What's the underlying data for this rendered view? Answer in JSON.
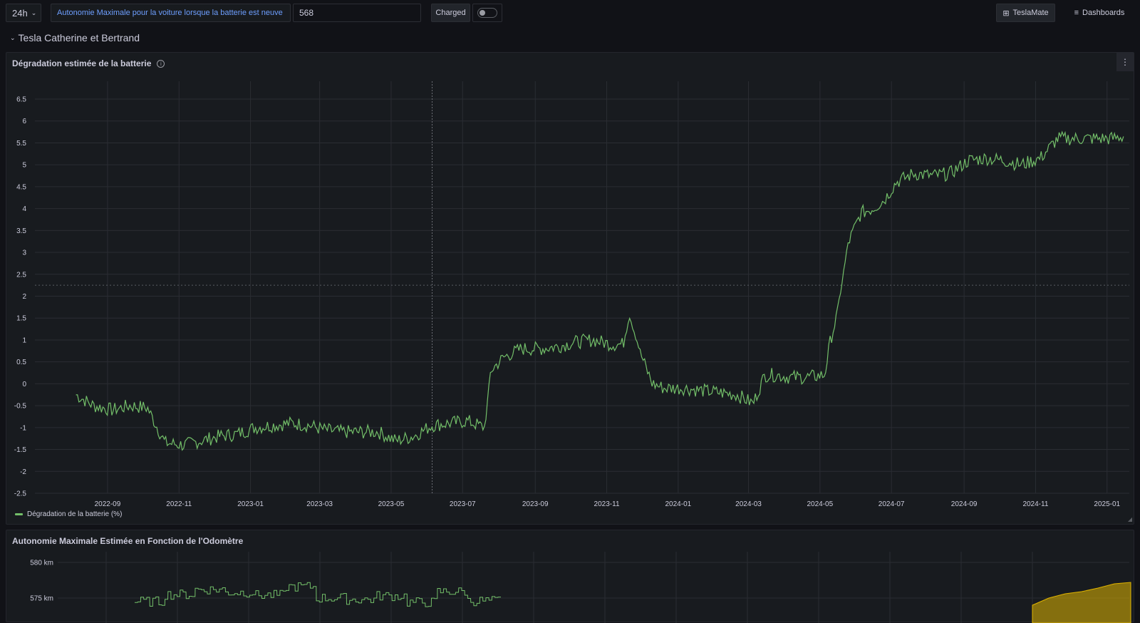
{
  "topbar": {
    "time_range": "24h",
    "variable_label": "Autonomie Maximale pour la voiture lorsque la batterie est neuve",
    "variable_value": "568",
    "charged_label": "Charged",
    "teslamate_label": "TeslaMate",
    "dashboards_label": "Dashboards"
  },
  "row": {
    "title": "Tesla Catherine et Bertrand"
  },
  "panel1": {
    "title": "Dégradation estimée de la batterie",
    "legend": "Dégradation de la batterie (%)"
  },
  "panel2": {
    "title": "Autonomie Maximale Estimée en Fonction de l'Odomètre"
  },
  "colors": {
    "background": "#111217",
    "panel": "#181b1f",
    "series_green": "#73bf69",
    "series_yellow": "#e0b400",
    "grid": "#2a2d33",
    "accent_blue": "#6e9fff"
  },
  "chart_data": [
    {
      "type": "line",
      "title": "Dégradation estimée de la batterie",
      "x_ticks": [
        "2022-09",
        "2022-11",
        "2023-01",
        "2023-03",
        "2023-05",
        "2023-07",
        "2023-09",
        "2023-11",
        "2024-01",
        "2024-03",
        "2024-05",
        "2024-07",
        "2024-09",
        "2024-11",
        "2025-01"
      ],
      "y_ticks": [
        "6.5",
        "6",
        "5.5",
        "5",
        "4.5",
        "4",
        "3.5",
        "3",
        "2.5",
        "2",
        "1.5",
        "1",
        "0.5",
        "0",
        "-0.5",
        "-1",
        "-1.5",
        "-2",
        "-2.5"
      ],
      "ylim": [
        -2.5,
        6.5
      ],
      "threshold": 2.25,
      "grid": true,
      "legend_position": "bottom-left",
      "series": [
        {
          "name": "Dégradation de la batterie (%)",
          "color": "#73bf69",
          "x": [
            "2022-08-05",
            "2022-08-20",
            "2022-09-05",
            "2022-09-20",
            "2022-10-05",
            "2022-10-20",
            "2022-11-05",
            "2022-11-20",
            "2022-12-05",
            "2022-12-20",
            "2023-01-05",
            "2023-01-20",
            "2023-02-05",
            "2023-02-20",
            "2023-03-05",
            "2023-03-20",
            "2023-04-05",
            "2023-04-20",
            "2023-05-05",
            "2023-05-20",
            "2023-06-05",
            "2023-06-20",
            "2023-07-05",
            "2023-07-20",
            "2023-07-25",
            "2023-08-05",
            "2023-08-20",
            "2023-09-05",
            "2023-09-20",
            "2023-10-05",
            "2023-10-20",
            "2023-11-05",
            "2023-11-15",
            "2023-11-20",
            "2023-12-01",
            "2023-12-10",
            "2023-12-20",
            "2024-01-05",
            "2024-01-20",
            "2024-02-05",
            "2024-02-20",
            "2024-03-05",
            "2024-03-15",
            "2024-03-25",
            "2024-04-05",
            "2024-04-20",
            "2024-05-05",
            "2024-05-10",
            "2024-05-15",
            "2024-05-25",
            "2024-06-05",
            "2024-06-15",
            "2024-06-25",
            "2024-07-05",
            "2024-07-20",
            "2024-08-05",
            "2024-08-20",
            "2024-09-05",
            "2024-09-20",
            "2024-10-05",
            "2024-10-20",
            "2024-11-05",
            "2024-11-20",
            "2024-12-05",
            "2024-12-20",
            "2025-01-05",
            "2025-01-15"
          ],
          "values": [
            -0.25,
            -0.5,
            -0.6,
            -0.5,
            -0.55,
            -1.35,
            -1.4,
            -1.3,
            -1.2,
            -1.15,
            -1.0,
            -0.95,
            -0.9,
            -0.95,
            -1.05,
            -1.1,
            -1.1,
            -1.1,
            -1.3,
            -1.2,
            -0.95,
            -0.9,
            -0.85,
            -1.0,
            0.3,
            0.6,
            0.8,
            0.8,
            0.85,
            0.95,
            1.0,
            0.9,
            0.9,
            1.6,
            0.6,
            0.0,
            -0.1,
            -0.1,
            -0.15,
            -0.2,
            -0.25,
            -0.45,
            0.2,
            0.2,
            0.15,
            0.15,
            0.2,
            1.0,
            1.5,
            3.2,
            3.9,
            4.0,
            4.2,
            4.6,
            4.8,
            4.75,
            4.8,
            5.1,
            5.15,
            5.1,
            5.0,
            5.15,
            5.6,
            5.6,
            5.6,
            5.6,
            5.65
          ]
        }
      ]
    },
    {
      "type": "bar",
      "title": "Autonomie Maximale Estimée en Fonction de l'Odomètre",
      "y_ticks": [
        "580 km",
        "575 km"
      ],
      "series": [
        {
          "color": "#73bf69",
          "values": [
            574.5,
            575.5,
            576.2,
            575.8,
            575.4,
            576.6,
            575.0,
            574.8,
            575.3,
            574.4,
            575.9,
            574.6
          ]
        },
        {
          "color": "#e0b400",
          "values": [
            574.0,
            575.0,
            575.6,
            575.9,
            576.4,
            577.0,
            577.2
          ]
        }
      ]
    }
  ]
}
